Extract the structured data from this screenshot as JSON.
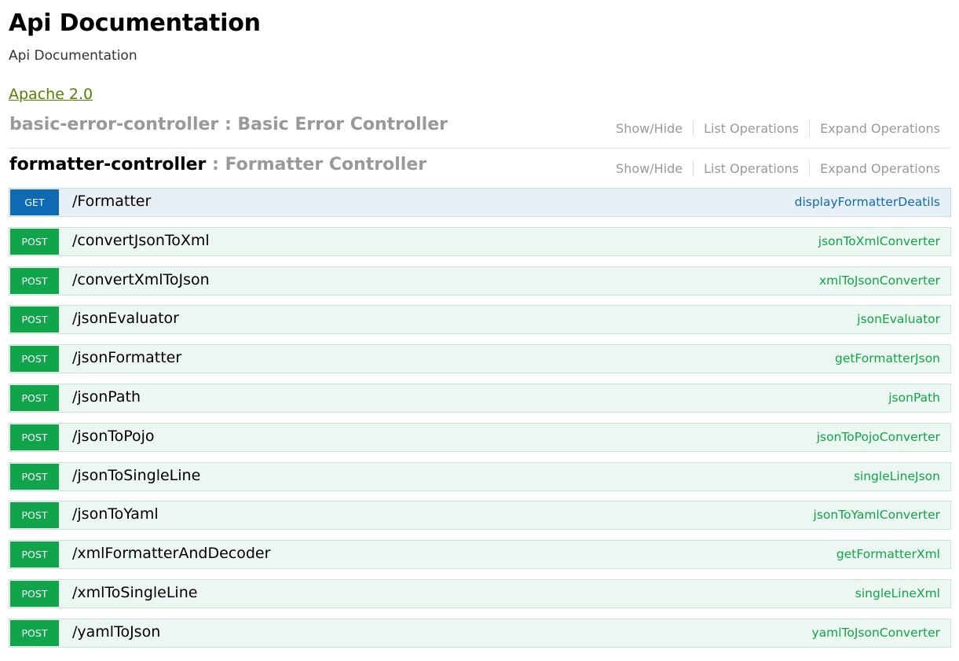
{
  "title": "Api Documentation",
  "description": "Api Documentation",
  "license": "Apache 2.0",
  "resources": [
    {
      "name": "basic-error-controller",
      "separator": " : ",
      "description": "Basic Error Controller",
      "ops": [
        "Show/Hide",
        "List Operations",
        "Expand Operations"
      ]
    },
    {
      "name": "formatter-controller",
      "separator": " : ",
      "description": "Formatter Controller",
      "ops": [
        "Show/Hide",
        "List Operations",
        "Expand Operations"
      ]
    }
  ],
  "endpoints": [
    {
      "method": "GET",
      "path": "/Formatter",
      "nickname": "displayFormatterDeatils"
    },
    {
      "method": "POST",
      "path": "/convertJsonToXml",
      "nickname": "jsonToXmlConverter"
    },
    {
      "method": "POST",
      "path": "/convertXmlToJson",
      "nickname": "xmlToJsonConverter"
    },
    {
      "method": "POST",
      "path": "/jsonEvaluator",
      "nickname": "jsonEvaluator"
    },
    {
      "method": "POST",
      "path": "/jsonFormatter",
      "nickname": "getFormatterJson"
    },
    {
      "method": "POST",
      "path": "/jsonPath",
      "nickname": "jsonPath"
    },
    {
      "method": "POST",
      "path": "/jsonToPojo",
      "nickname": "jsonToPojoConverter"
    },
    {
      "method": "POST",
      "path": "/jsonToSingleLine",
      "nickname": "singleLineJson"
    },
    {
      "method": "POST",
      "path": "/jsonToYaml",
      "nickname": "jsonToYamlConverter"
    },
    {
      "method": "POST",
      "path": "/xmlFormatterAndDecoder",
      "nickname": "getFormatterXml"
    },
    {
      "method": "POST",
      "path": "/xmlToSingleLine",
      "nickname": "singleLineXml"
    },
    {
      "method": "POST",
      "path": "/yamlToJson",
      "nickname": "yamlToJsonConverter"
    }
  ],
  "colors": {
    "get": "#0f6ab4",
    "post": "#10a54a",
    "license_link": "#547f00",
    "muted": "#999999"
  }
}
